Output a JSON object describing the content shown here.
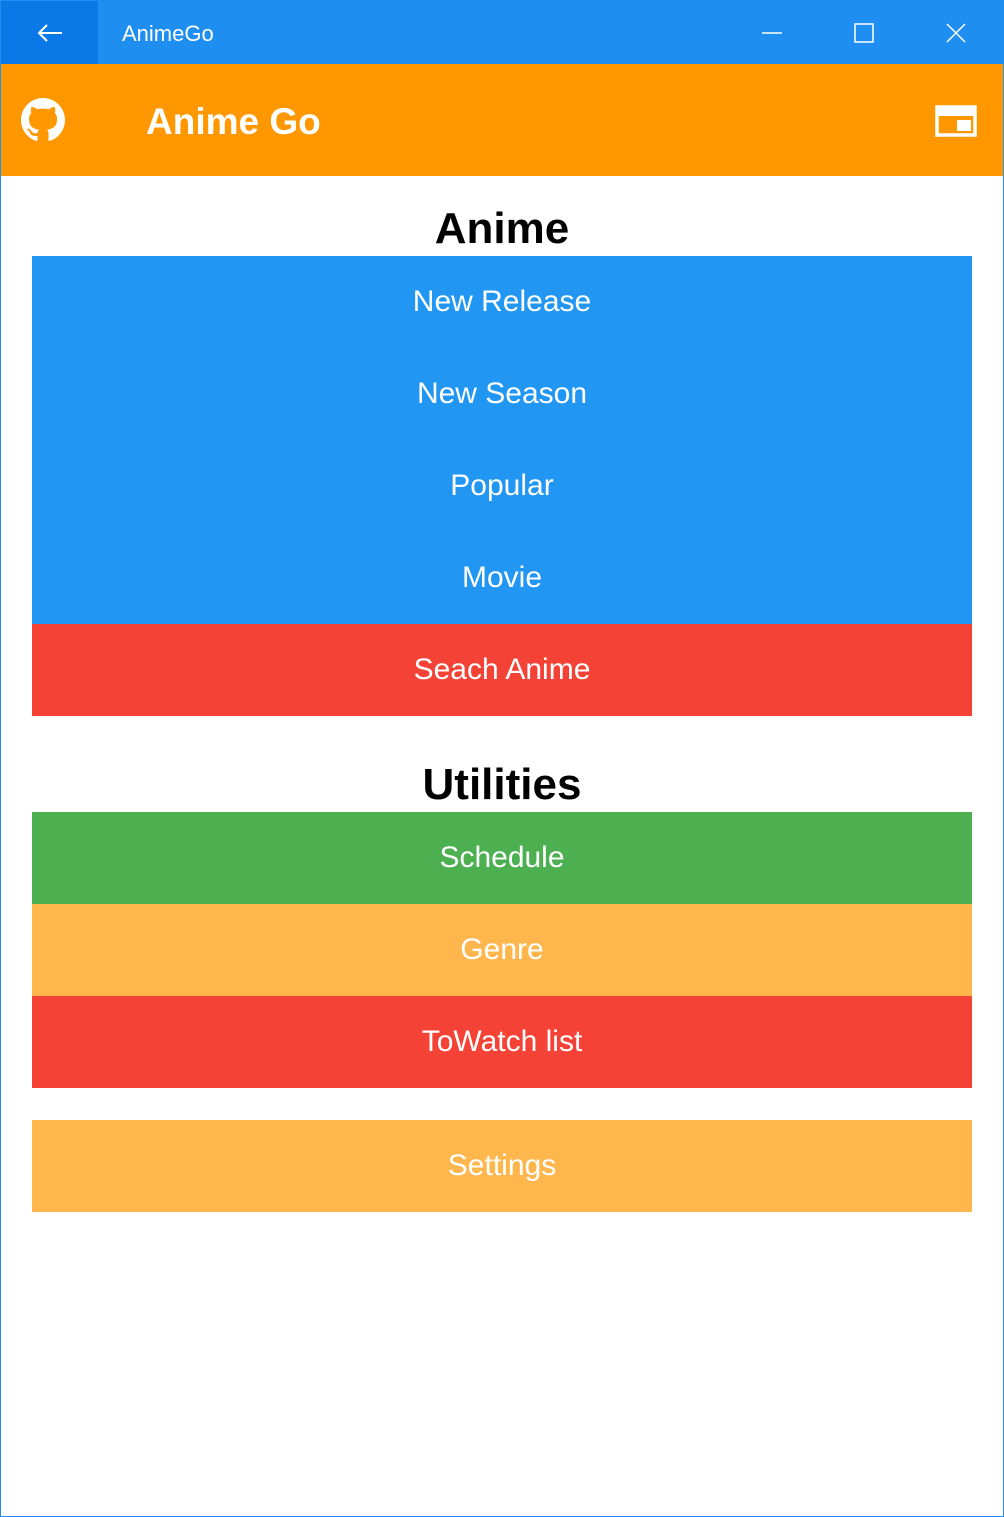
{
  "window": {
    "title": "AnimeGo",
    "icons": {
      "back": "back-arrow-icon",
      "minimize": "minimize-icon",
      "maximize": "maximize-icon",
      "close": "close-icon"
    }
  },
  "header": {
    "title": "Anime Go",
    "icons": {
      "left": "github-icon",
      "right": "layout-panel-icon"
    },
    "color": "#ff9800"
  },
  "anime_section": {
    "title": "Anime",
    "items": [
      {
        "label": "New Release",
        "color": "#2196f3"
      },
      {
        "label": "New Season",
        "color": "#2196f3"
      },
      {
        "label": "Popular",
        "color": "#2196f3"
      },
      {
        "label": "Movie",
        "color": "#2196f3"
      },
      {
        "label": "Seach Anime",
        "color": "#f44336"
      }
    ]
  },
  "utilities_section": {
    "title": "Utilities",
    "items": [
      {
        "label": "Schedule",
        "color": "#4caf50"
      },
      {
        "label": "Genre",
        "color": "#ffb74d"
      },
      {
        "label": "ToWatch list",
        "color": "#f44336"
      }
    ]
  },
  "settings": {
    "label": "Settings",
    "color": "#ffb74d"
  },
  "colors": {
    "titlebar": "#1f8ef1",
    "accent_blue": "#2196f3"
  }
}
